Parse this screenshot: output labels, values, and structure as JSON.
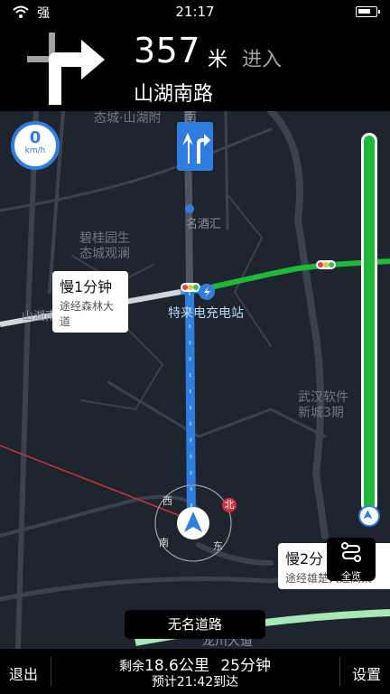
{
  "status": {
    "carrier": "强",
    "time": "21:17",
    "battery_level": 0.75
  },
  "guidance": {
    "distance": "357",
    "unit": "米",
    "action": "进入",
    "road": "山湖南路"
  },
  "speed": {
    "value": "0",
    "unit": "km/h"
  },
  "map": {
    "labels": {
      "top_left": "态城·山湖附",
      "south_vertical": "南 路",
      "poi_bank": "名酒汇",
      "community": "碧桂园生\n态城观澜",
      "shanhu_road": "山湖南路",
      "charging": "特来电充电站",
      "software_city": "武汉软件\n新城3期",
      "longchuan": "龙川大道",
      "compass_n": "北",
      "compass_s": "南",
      "compass_w": "西",
      "compass_e": "东"
    },
    "bubble_left": {
      "title": "慢1分钟",
      "subtitle": "途经森林大道"
    },
    "bubble_right": {
      "title": "慢2分",
      "subtitle": "途经雄楚大道高架"
    },
    "overview_label": "全览",
    "current_road": "无名道路"
  },
  "bottom": {
    "exit": "退出",
    "remaining_prefix": "剩余",
    "remaining_distance": "18.6公里",
    "remaining_time": "25分钟",
    "eta": "预计21:42到达",
    "settings": "设置"
  },
  "colors": {
    "route_blue": "#2f7de1",
    "traffic_green": "#1fb93a",
    "map_bg": "#1f252e"
  }
}
